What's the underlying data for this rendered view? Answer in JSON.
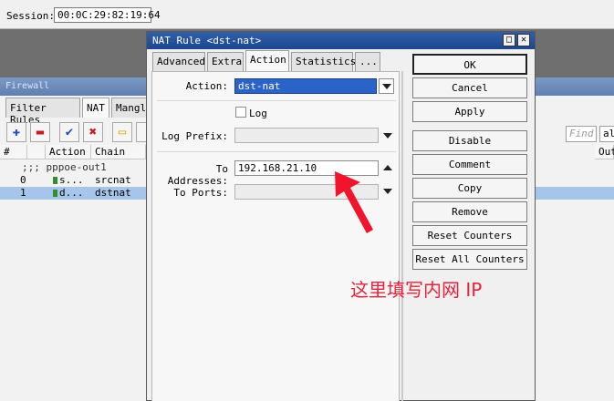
{
  "session": {
    "label": "Session:",
    "value": "00:0C:29:82:19:64"
  },
  "firewall": {
    "title": "Firewall",
    "tabs": [
      "Filter Rules",
      "NAT",
      "Mangle"
    ],
    "find_placeholder": "Find",
    "scope_value": "al",
    "columns": [
      "#",
      "Action",
      "Chain",
      "Out"
    ],
    "comment_row": ";;; pppoe-out1",
    "rows": [
      {
        "num": "0",
        "action": "s...",
        "chain": "srcnat"
      },
      {
        "num": "1",
        "action": "d...",
        "chain": "dstnat"
      }
    ]
  },
  "dialog": {
    "title": "NAT Rule <dst-nat>",
    "tabs": [
      "Advanced",
      "Extra",
      "Action",
      "Statistics",
      "..."
    ],
    "action_label": "Action:",
    "action_value": "dst-nat",
    "log_label": "Log",
    "log_prefix_label": "Log Prefix:",
    "to_addresses_label": "To Addresses:",
    "to_addresses_value": "192.168.21.10",
    "to_ports_label": "To Ports:",
    "buttons": [
      "OK",
      "Cancel",
      "Apply",
      "Disable",
      "Comment",
      "Copy",
      "Remove",
      "Reset Counters",
      "Reset All Counters"
    ]
  },
  "annotation": {
    "text": "这里填写内网 IP",
    "color": "#e8223a"
  }
}
